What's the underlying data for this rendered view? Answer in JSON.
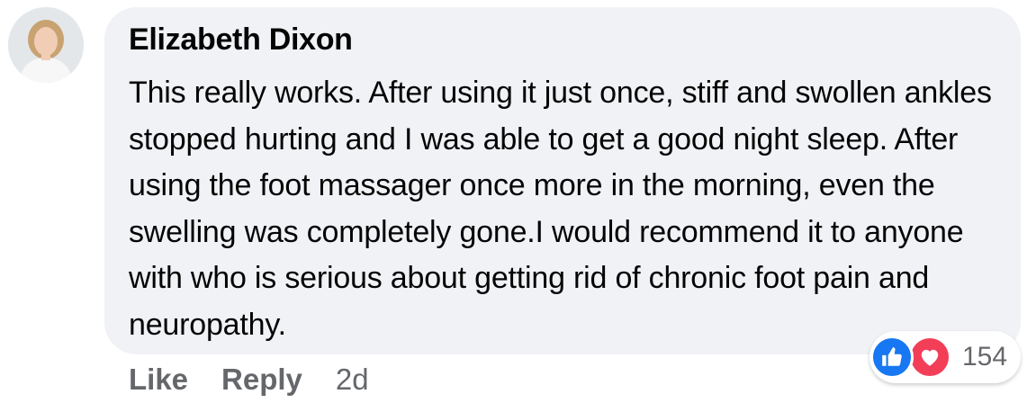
{
  "comment": {
    "author": "Elizabeth Dixon",
    "text": "This really works. After using it just once, stiff and swollen ankles stopped hurting and I was able to get a good night sleep. After using the foot massager once more in the morning, even the swelling was completely gone.I would recommend it to anyone with who is serious about getting rid of chronic foot pain and neuropathy.",
    "avatar_icon": "user-avatar",
    "timestamp": "2d"
  },
  "reactions": {
    "icons": [
      "thumbs-up-icon",
      "heart-icon"
    ],
    "like_color": "#1877f2",
    "love_color": "#f33e58",
    "count": "154"
  },
  "actions": {
    "like_label": "Like",
    "reply_label": "Reply"
  },
  "colors": {
    "bubble_background": "#f0f2f5",
    "text": "#050505",
    "secondary_text": "#65676b"
  }
}
